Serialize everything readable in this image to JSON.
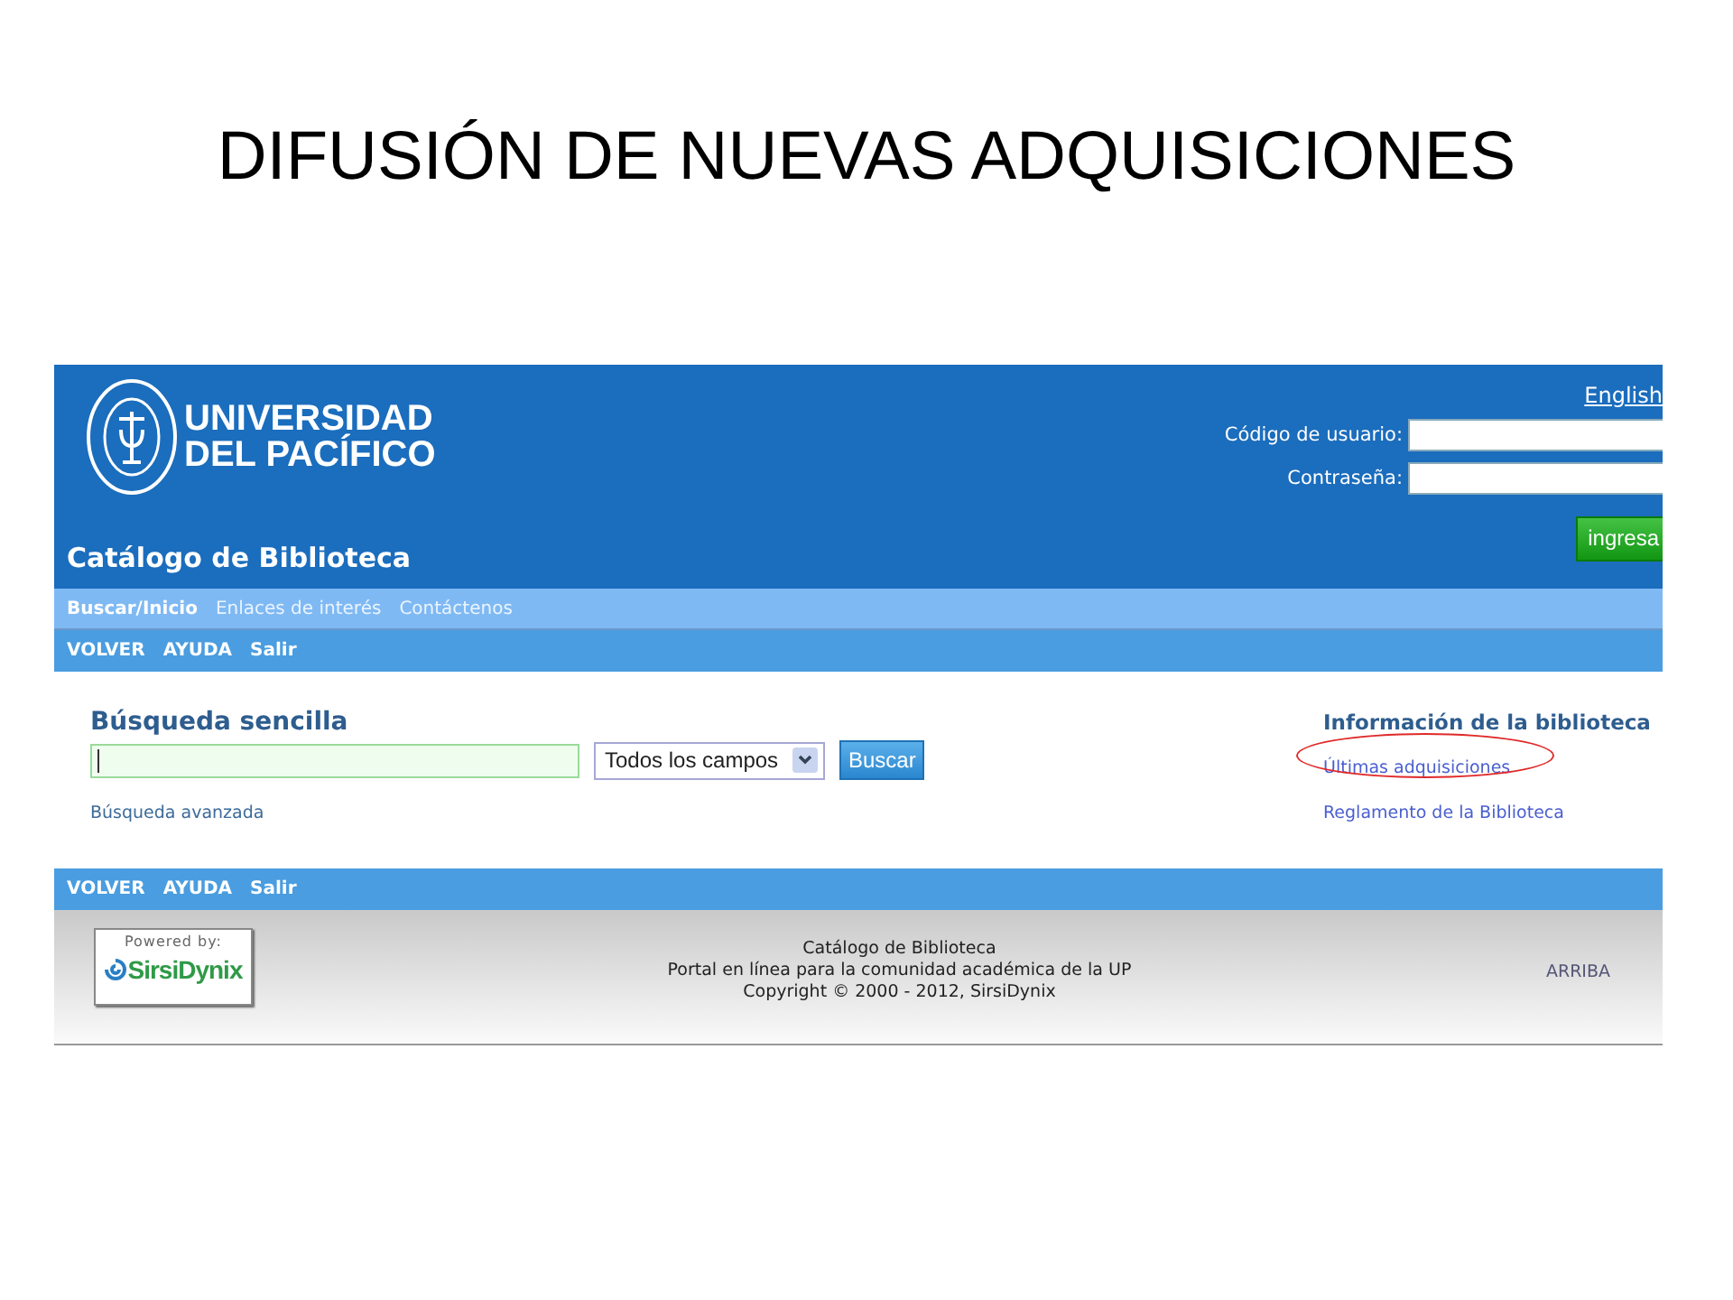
{
  "slide_title": "DIFUSIÓN DE NUEVAS ADQUISICIONES",
  "header": {
    "logo_text": [
      "UNIVERSIDAD",
      "DEL PACÍFICO"
    ],
    "catalog_title": "Catálogo de Biblioteca",
    "language_link": "English",
    "login": {
      "fields": [
        {
          "label": "Código de usuario:"
        },
        {
          "label": "Contraseña:"
        }
      ],
      "submit": "ingresa"
    }
  },
  "menu": [
    {
      "label": "Buscar/Inicio",
      "selected": true
    },
    {
      "label": "Enlaces de interés",
      "selected": false
    },
    {
      "label": "Contáctenos",
      "selected": false
    }
  ],
  "top_links": [
    "VOLVER",
    "AYUDA",
    "Salir"
  ],
  "search": {
    "heading": "Búsqueda sencilla",
    "field_type": "Todos los campos",
    "button": "Buscar",
    "advanced_link": "Búsqueda avanzada"
  },
  "info": {
    "heading": "Información de la biblioteca",
    "links": [
      {
        "label": "Últimas adquisiciones",
        "highlighted": true
      },
      {
        "label": "Reglamento de la Biblioteca",
        "highlighted": false
      }
    ]
  },
  "bottom_links": [
    "VOLVER",
    "AYUDA",
    "Salir"
  ],
  "footer": {
    "powered_by": "Powered by:",
    "vendor": "SirsiDynix",
    "lines": [
      "Catálogo de Biblioteca",
      "Portal en línea para la comunidad académica de la UP",
      "Copyright © 2000 - 2012, SirsiDynix"
    ],
    "top_link": "ARRIBA"
  }
}
